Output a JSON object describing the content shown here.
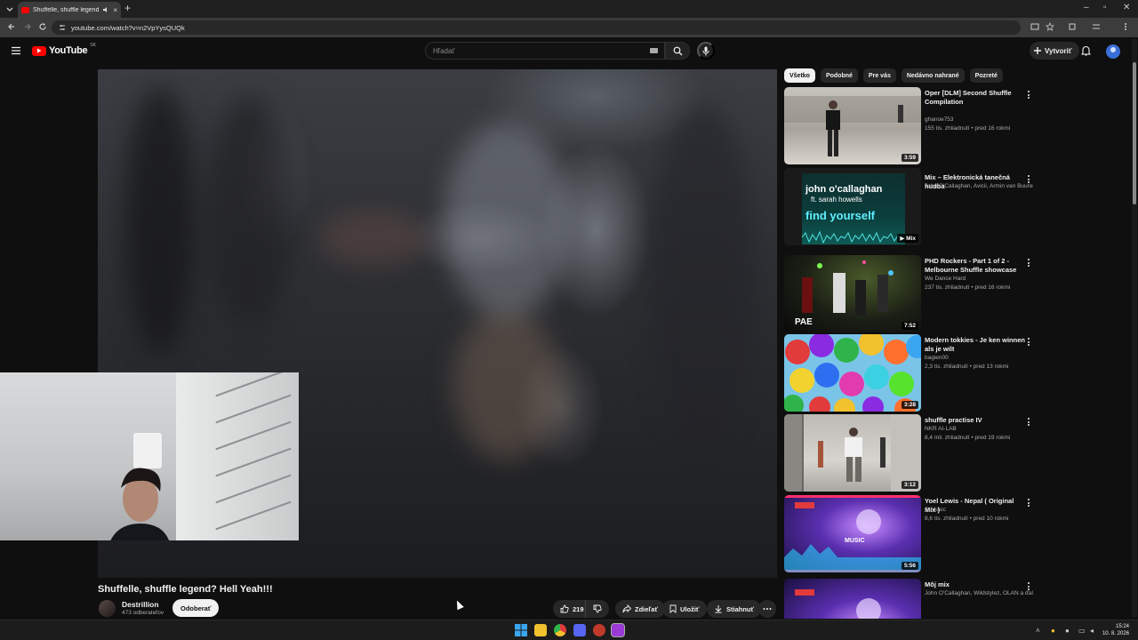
{
  "browser": {
    "tab_title": "Shuffelle, shuffle legend? H",
    "tab_close": "×",
    "new_tab": "+",
    "url": "youtube.com/watch?v=n2VpYysQUQk",
    "window_min": "–",
    "window_max": "▫",
    "window_close": "✕"
  },
  "youtube": {
    "logo_text": "YouTube",
    "country": "SK",
    "search_placeholder": "Hľadať",
    "create_label": "Vytvoriť"
  },
  "video": {
    "title": "Shuffelle, shuffle legend? Hell Yeah!!!",
    "channel": "Destrillion",
    "subscribers": "473 odberateľov",
    "unsubscribe_label": "Odoberať",
    "likes": "219",
    "share_label": "Zdieľať",
    "save_label": "Uložiť",
    "download_label": "Stiahnuť"
  },
  "sidebar": {
    "chips": [
      "Všetko",
      "Podobné",
      "Pre vás",
      "Nedávno nahrané",
      "Pozreté"
    ],
    "recommendations": [
      {
        "title": "Oper [DLM] Second Shuffle Compilation",
        "channel": "ghanoe753",
        "meta": "155 tis. zhliadnutí • pred 16 rokmi",
        "duration": "3:59"
      },
      {
        "title": "Mix – Elektronická tanečná hudba",
        "channel": "John O'Callaghan, Avicii, Armin van Buuren...",
        "meta": "",
        "duration": "Mix",
        "thumb_line1": "john o'callaghan",
        "thumb_line2": "ft. sarah howells",
        "thumb_line3": "find yourself"
      },
      {
        "title": "PHD Rockers - Part 1 of 2 - Melbourne Shuffle showcase",
        "channel": "We Dance Hard",
        "meta": "237 tis. zhliadnutí • pred 16 rokmi",
        "duration": "7:52",
        "thumb_text": "PAE"
      },
      {
        "title": "Modern tokkies - Je ken winnen als je wilt",
        "channel": "bagien00",
        "meta": "2,3 tis. zhliadnutí • pred 13 rokmi",
        "duration": "3:28"
      },
      {
        "title": "shuffle practise IV",
        "channel": "NKR AI-LAB",
        "meta": "8,4 mil. zhliadnutí • pred 19 rokmi",
        "duration": "3:12"
      },
      {
        "title": "Yoel Lewis - Nepal ( Original Mix )",
        "channel": "G Music",
        "meta": "8,6 tis. zhliadnutí • pred 10 rokmi",
        "duration": "5:56",
        "thumb_text": "MUSIC"
      },
      {
        "title": "Môj mix",
        "channel": "John O'Callaghan, Wildstylez, OLAN a ďalší",
        "meta": "",
        "duration": ""
      }
    ]
  },
  "taskbar": {
    "time": "15:24",
    "date": "10. 8. 2026"
  },
  "colors": {
    "yt_red": "#ff0000",
    "background": "#0f0f0f",
    "pill": "#272727"
  }
}
